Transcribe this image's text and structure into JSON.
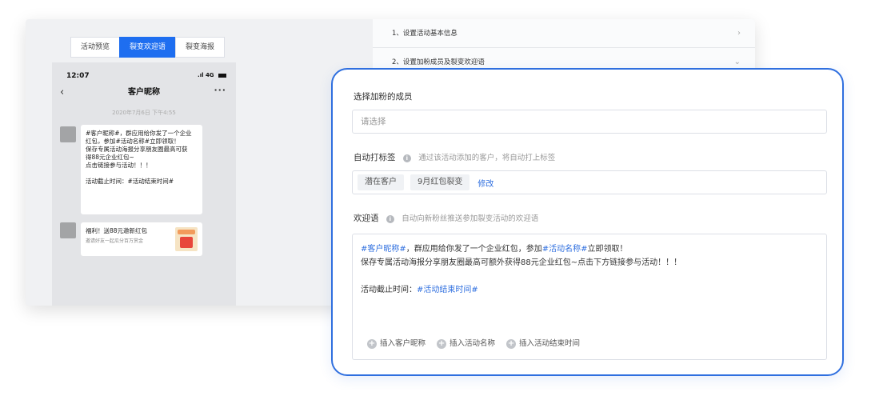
{
  "tabs": [
    {
      "label": "活动预览"
    },
    {
      "label": "裂变欢迎语"
    },
    {
      "label": "裂变海报"
    }
  ],
  "phone": {
    "time": "12:07",
    "signal": "4G",
    "title": "客户昵称",
    "date": "2020年7月6日 下午4:55",
    "message_lines": [
      "#客户昵称#，群应用给你发了一个企业",
      "红包，参加#活动名称#立即领取！",
      "保存专属活动海报分享朋友圈最高可获",
      "得88元企业红包~",
      "点击链接参与活动！！！",
      "",
      "活动截止时间：#活动结束时间#"
    ],
    "card": {
      "title": "福利！送88元邀新红包",
      "subtitle": "邀请好友一起瓜分百万赏金"
    }
  },
  "steps": [
    {
      "label": "1、设置活动基本信息",
      "icon": "chevron-right-icon"
    },
    {
      "label": "2、设置加粉成员及裂变欢迎语",
      "icon": "chevron-down-icon"
    }
  ],
  "panel": {
    "member_label": "选择加粉的成员",
    "member_placeholder": "请选择",
    "tag_label": "自动打标签",
    "tag_hint": "通过该活动添加的客户，将自动打上标签",
    "tags": [
      "潜在客户",
      "9月红包裂变"
    ],
    "tag_edit": "修改",
    "welcome_label": "欢迎语",
    "welcome_hint": "自动向新粉丝推送参加裂变活动的欢迎语",
    "editor": {
      "line1": {
        "var1": "#客户昵称#",
        "text1": "，群应用给你发了一个企业红包，参加",
        "var2": "#活动名称#",
        "text2": "立即领取！"
      },
      "line2": "保存专属活动海报分享朋友圈最高可额外获得88元企业红包~点击下方链接参与活动！！！",
      "line3": {
        "text": "活动截止时间：",
        "var": "#活动结束时间#"
      }
    },
    "insert_buttons": [
      {
        "label": "插入客户昵称"
      },
      {
        "label": "插入活动名称"
      },
      {
        "label": "插入活动结束时间"
      }
    ]
  },
  "colors": {
    "accent": "#2f6fdf",
    "tab_active": "#1e6ef0"
  }
}
